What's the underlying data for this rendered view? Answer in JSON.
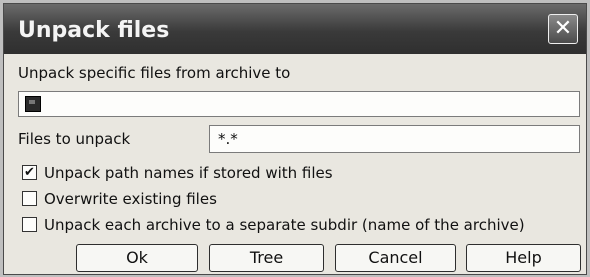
{
  "dialog": {
    "title": "Unpack files",
    "close_symbol": "✕",
    "target_label": "Unpack specific files from archive to",
    "target_value": "",
    "files_label": "Files to unpack",
    "files_value": "*.*"
  },
  "options": [
    {
      "label": "Unpack path names if stored with files",
      "checked": true
    },
    {
      "label": "Overwrite existing files",
      "checked": false
    },
    {
      "label": "Unpack each archive to a separate subdir (name of the archive)",
      "checked": false
    }
  ],
  "buttons": {
    "ok": "Ok",
    "tree": "Tree",
    "cancel": "Cancel",
    "help": "Help"
  },
  "icons": {
    "drive": "drive-icon",
    "check": "✔"
  }
}
